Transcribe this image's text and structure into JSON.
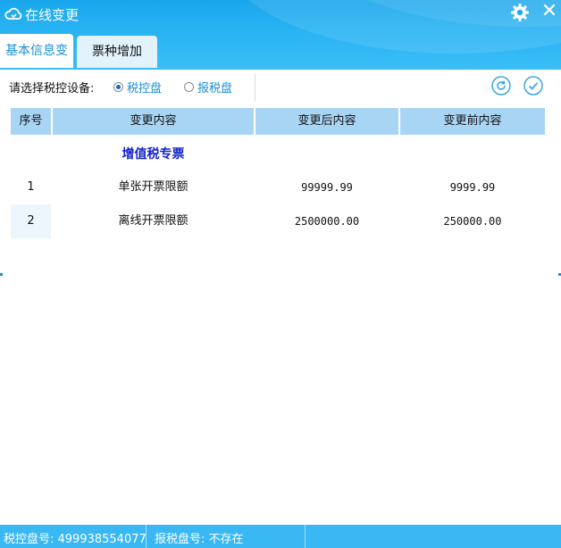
{
  "window": {
    "title": "在线变更"
  },
  "tabs": [
    {
      "label": "基本信息变更"
    },
    {
      "label": "票种增加"
    }
  ],
  "toolbar": {
    "device_label": "请选择税控设备:",
    "options": [
      {
        "label": "税控盘",
        "selected": true
      },
      {
        "label": "报税盘",
        "selected": false
      }
    ]
  },
  "table": {
    "headers": [
      "序号",
      "变更内容",
      "变更后内容",
      "变更前内容"
    ],
    "group_title": "增值税专票",
    "rows": [
      {
        "seq": "1",
        "content": "单张开票限额",
        "after": "99999.99",
        "before": "9999.99"
      },
      {
        "seq": "2",
        "content": "离线开票限额",
        "after": "2500000.00",
        "before": "250000.00"
      }
    ]
  },
  "status": {
    "tax_disk_no": "税控盘号: 499938554077",
    "report_disk_no": "报税盘号: 不存在"
  },
  "colors": {
    "titlebar": "#19a6ec",
    "accent": "#1a8fd8",
    "header_bg": "#a9d5f5",
    "group_title": "#1424c8",
    "statusbar": "#39b8f4"
  },
  "icons": [
    "cloud-app-icon",
    "gear-icon",
    "close-icon",
    "refresh-icon",
    "check-icon"
  ]
}
